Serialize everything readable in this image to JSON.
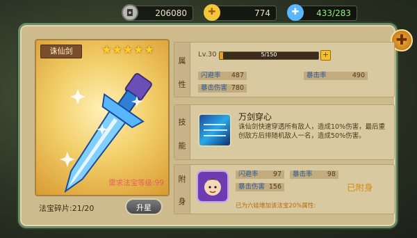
{
  "currencies": {
    "coins": {
      "icon": "silver-coin-icon",
      "value": "206080"
    },
    "gold": {
      "icon": "gold-ingot-icon",
      "value": "774"
    },
    "stamina": {
      "icon": "stamina-potion-icon",
      "value": "433/283"
    }
  },
  "weapon": {
    "name": "诛仙剑",
    "stars": 5,
    "requirement": "需求法宝等级:99",
    "fragments": "法宝碎片:21/20",
    "upgrade_label": "升星"
  },
  "attributes": {
    "section_label_top": "属",
    "section_label_bottom": "性",
    "level": "Lv.30",
    "exp": "5/150",
    "exp_fraction": 0.033,
    "stats": [
      {
        "label": "闪避率",
        "value": "487"
      },
      {
        "label": "暴击率",
        "value": "490"
      },
      {
        "label": "暴击伤害",
        "value": "780"
      }
    ]
  },
  "skill": {
    "section_label_top": "技",
    "section_label_bottom": "能",
    "name": "万剑穿心",
    "description": "诛仙剑快速穿透所有敌人，造成10%伤害，最后重创敌方后排随机敌人一名，造成50%伤害。"
  },
  "attach": {
    "section_label_top": "附",
    "section_label_bottom": "身",
    "stats": [
      {
        "label": "闪避率",
        "value": "97"
      },
      {
        "label": "暴击率",
        "value": "98"
      },
      {
        "label": "暴击伤害",
        "value": "156"
      }
    ],
    "status": "已附身",
    "description": "已为六娃增加该法宝20%属性:"
  },
  "colors": {
    "panel": "#cdbb8d",
    "accent_gold": "#d58a12",
    "stat_label": "#2f5a9c",
    "requirement_red": "#e46060"
  }
}
